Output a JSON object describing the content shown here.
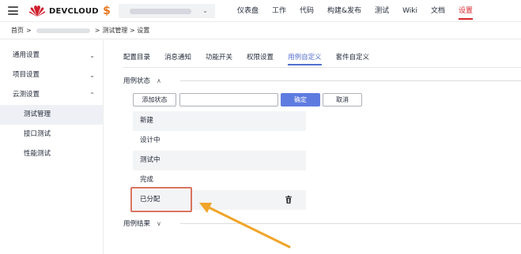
{
  "header": {
    "brand": "DEVCLOUD",
    "project_icon": "dollar-icon",
    "nav": [
      "仪表盘",
      "工作",
      "代码",
      "构建&发布",
      "测试",
      "Wiki",
      "文档",
      "设置"
    ],
    "active_nav": "设置",
    "accent_color": "#d6282f"
  },
  "breadcrumb": {
    "home": "首页",
    "sep1": ">",
    "sep2": ">",
    "path": "测试管理 > 设置"
  },
  "sidebar": {
    "groups": [
      {
        "label": "通用设置",
        "chevron": "chevron-down-icon"
      },
      {
        "label": "项目设置",
        "chevron": "chevron-down-icon"
      },
      {
        "label": "云测设置",
        "chevron": "chevron-up-icon"
      }
    ],
    "sub_items": [
      "测试管理",
      "接口测试",
      "性能测试"
    ],
    "active_sub": "测试管理"
  },
  "tabs": {
    "items": [
      "配置目录",
      "消息通知",
      "功能开关",
      "权限设置",
      "用例自定义",
      "套件自定义"
    ],
    "active": "用例自定义",
    "active_color": "#526ecc"
  },
  "case_status": {
    "title": "用例状态",
    "toggle": "∧",
    "add_button": "添加状态",
    "input_value": "",
    "confirm_button": "确定",
    "cancel_button": "取消",
    "items": [
      "新建",
      "设计中",
      "测试中",
      "完成",
      "已分配"
    ]
  },
  "case_result": {
    "title": "用例结果",
    "toggle": "∨"
  },
  "colors": {
    "primary_button": "#5e7ce0",
    "highlight_border": "#d9735f",
    "arrow": "#f0a52a"
  }
}
